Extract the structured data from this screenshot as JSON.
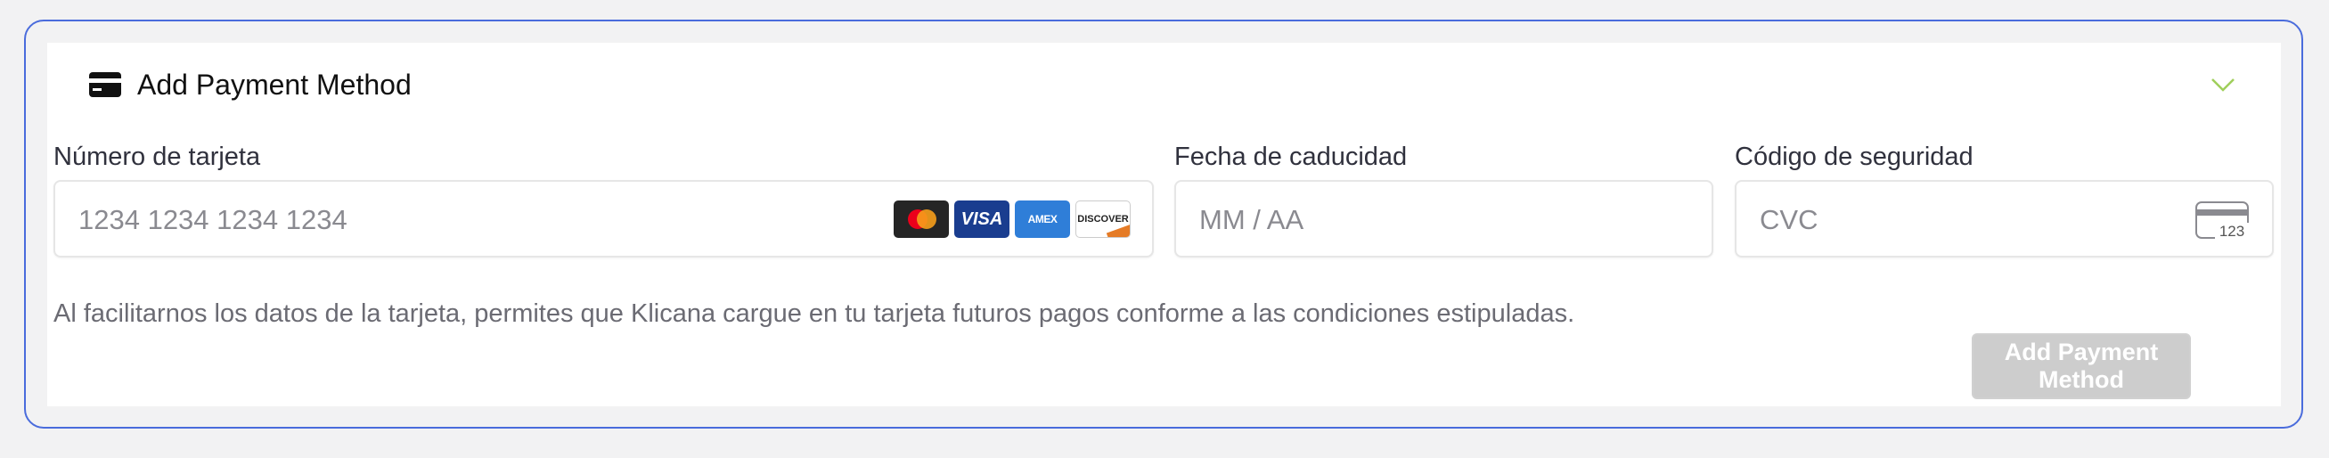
{
  "header": {
    "title": "Add Payment Method",
    "icon": "credit-card-icon",
    "toggle_icon": "chevron-down-icon"
  },
  "card_number": {
    "label": "Número de tarjeta",
    "placeholder": "1234 1234 1234 1234",
    "brands": [
      "mastercard",
      "visa",
      "amex",
      "discover"
    ],
    "visa_text": "VISA",
    "amex_text": "AMEX",
    "discover_text": "DISCOVER"
  },
  "expiry": {
    "label": "Fecha de caducidad",
    "placeholder": "MM / AA"
  },
  "security_code": {
    "label": "Código de seguridad",
    "placeholder": "CVC",
    "icon_text": "123"
  },
  "notice": "Al facilitarnos los datos de la tarjeta, permites que Klicana cargue en tu tarjeta futuros pagos conforme a las condiciones estipuladas.",
  "submit": {
    "label": "Add Payment Method",
    "disabled": true
  },
  "colors": {
    "accent_border": "#4a6cdc",
    "chevron": "#9fcf5b",
    "button_disabled": "#cdcdcd"
  }
}
